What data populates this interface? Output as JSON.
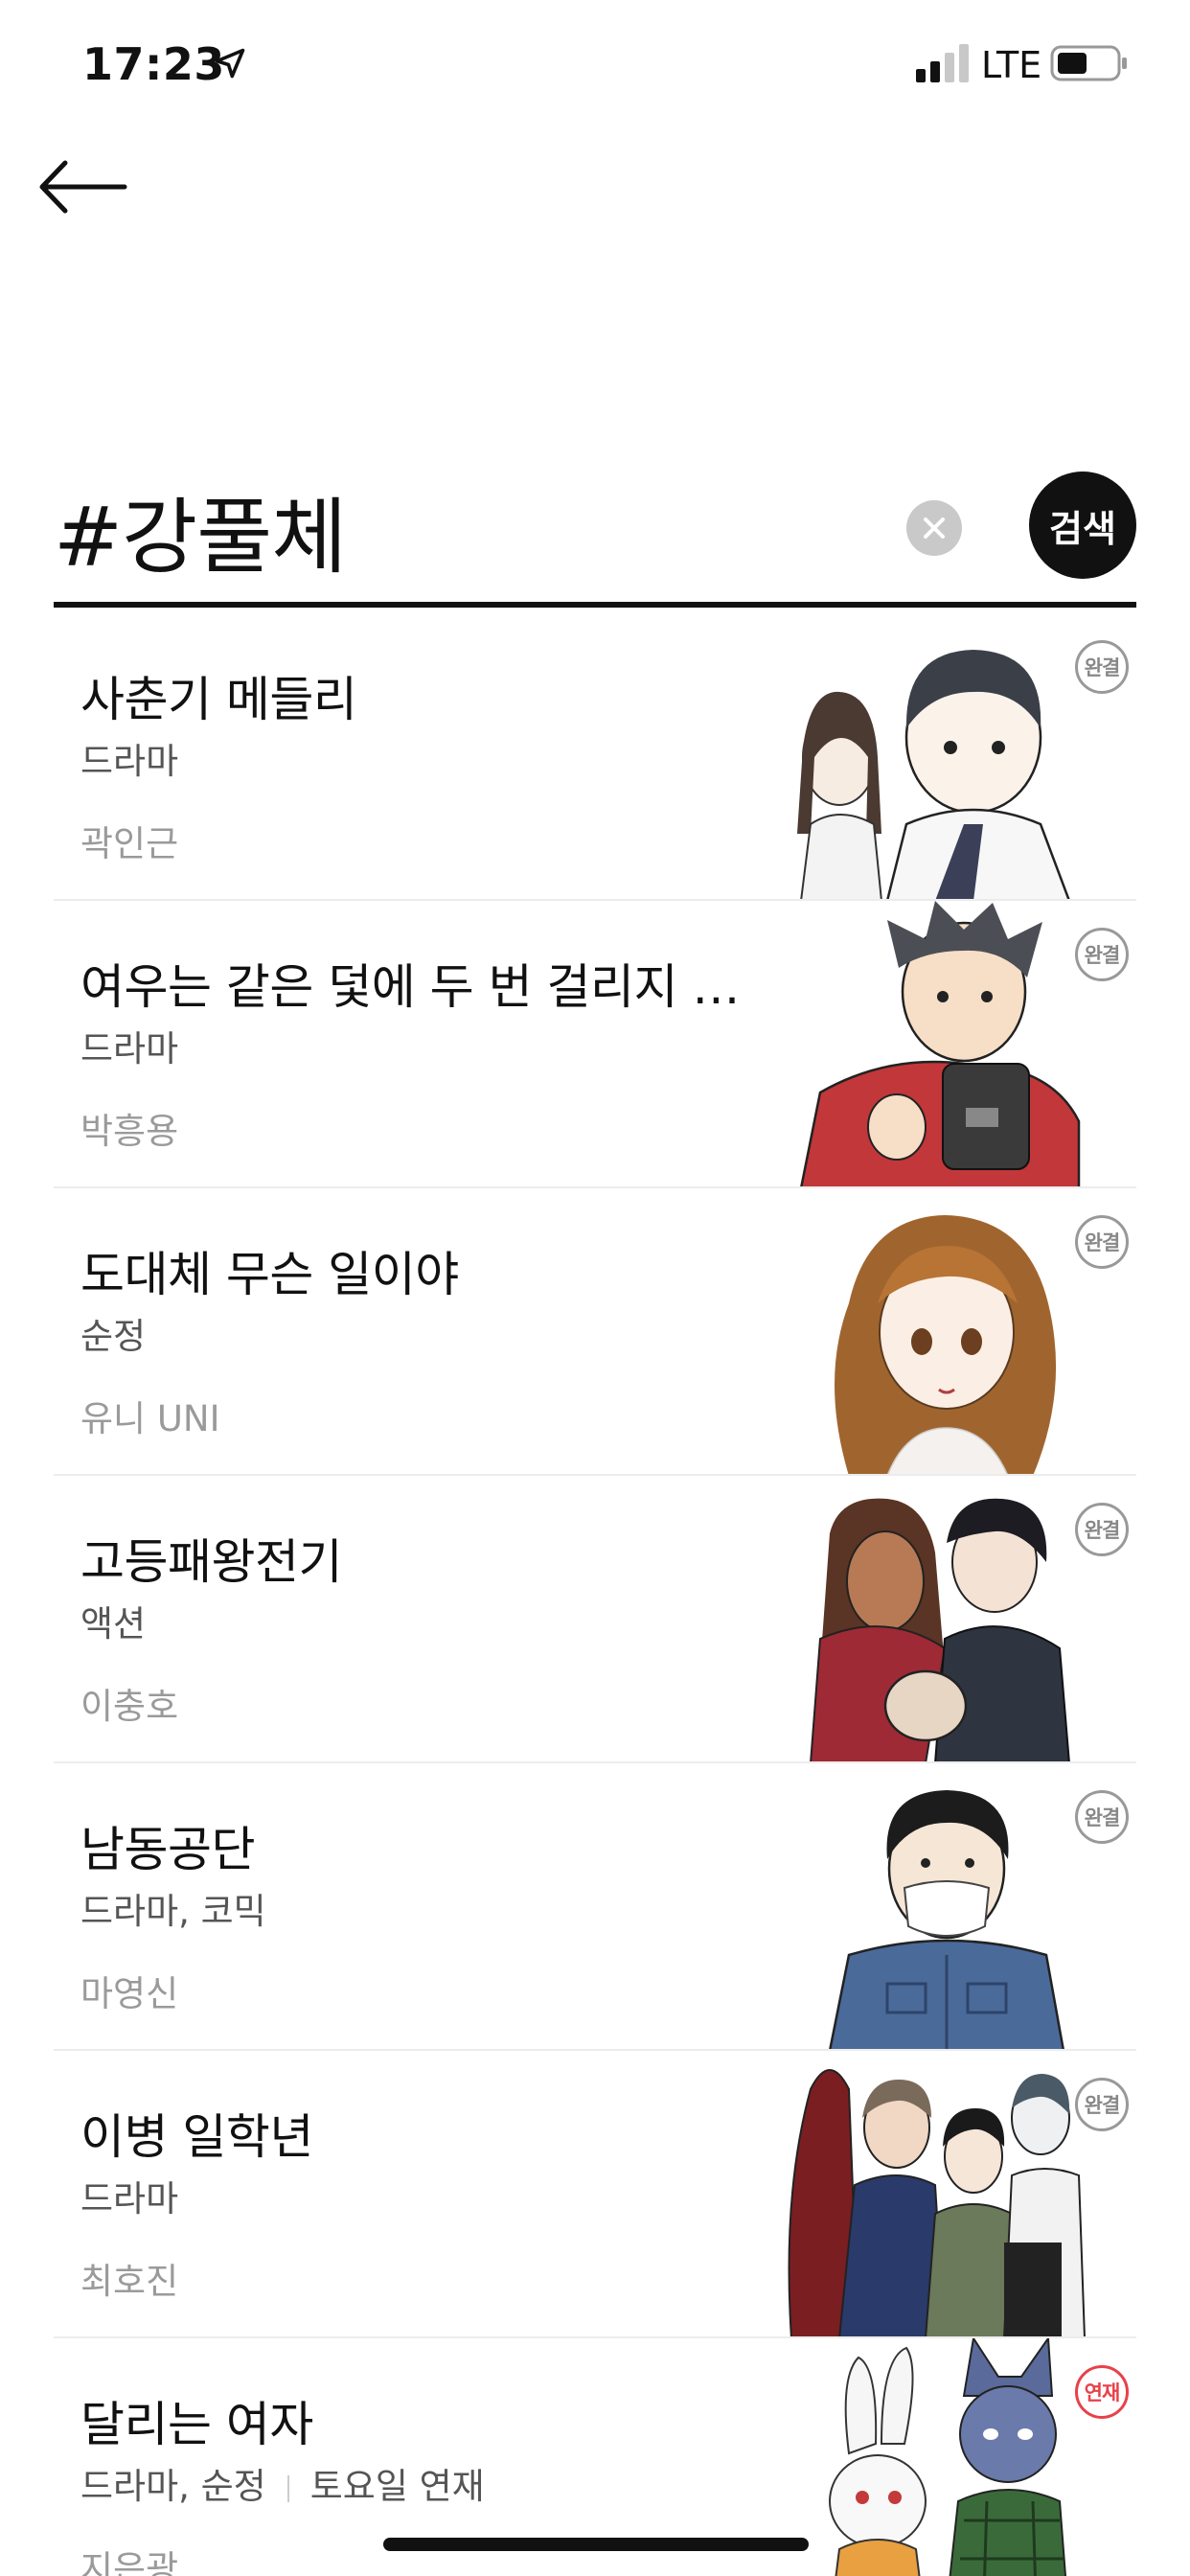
{
  "status_bar": {
    "time": "17:23",
    "network": "LTE"
  },
  "search": {
    "query": "#강풀체",
    "button_label": "검색"
  },
  "results": [
    {
      "title": "사춘기 메들리",
      "genre": "드라마",
      "schedule": "",
      "author": "곽인근",
      "badge": "완결",
      "status": "completed"
    },
    {
      "title": "여우는 같은 덫에 두 번 걸리지 않…",
      "genre": "드라마",
      "schedule": "",
      "author": "박흥용",
      "badge": "완결",
      "status": "completed"
    },
    {
      "title": "도대체 무슨 일이야",
      "genre": "순정",
      "schedule": "",
      "author": "유니 UNI",
      "badge": "완결",
      "status": "completed"
    },
    {
      "title": "고등패왕전기",
      "genre": "액션",
      "schedule": "",
      "author": "이충호",
      "badge": "완결",
      "status": "completed"
    },
    {
      "title": "남동공단",
      "genre": "드라마, 코믹",
      "schedule": "",
      "author": "마영신",
      "badge": "완결",
      "status": "completed"
    },
    {
      "title": "이병 일학년",
      "genre": "드라마",
      "schedule": "",
      "author": "최호진",
      "badge": "완결",
      "status": "completed"
    },
    {
      "title": "달리는 여자",
      "genre": "드라마, 순정",
      "schedule": "토요일 연재",
      "author": "지은광",
      "badge": "연재",
      "status": "ongoing"
    }
  ],
  "colors": {
    "accent_dark": "#111111",
    "badge_completed": "#999999",
    "badge_ongoing": "#e8414a",
    "divider": "#ececec"
  }
}
